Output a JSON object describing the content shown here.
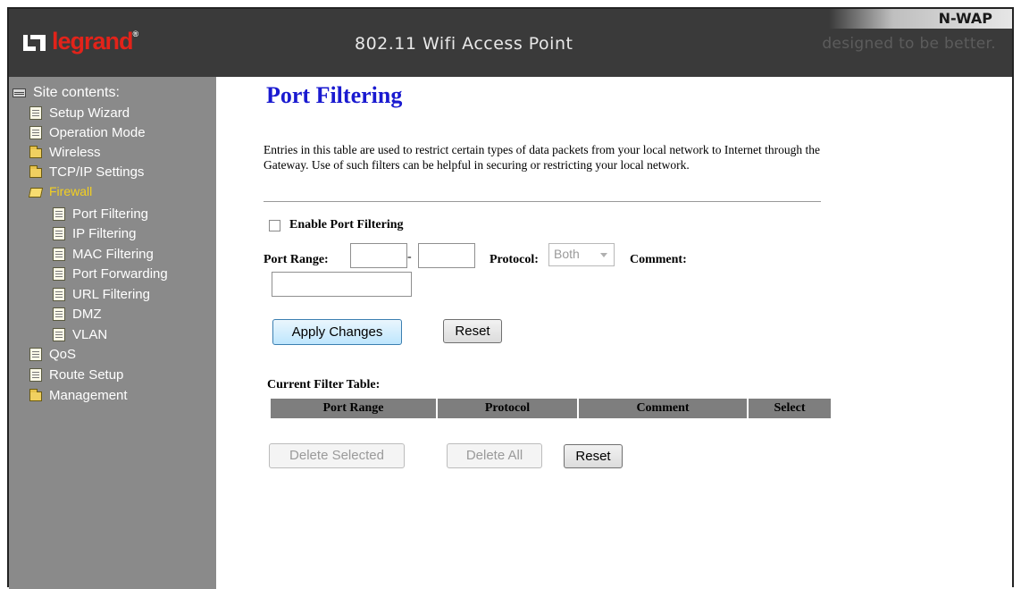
{
  "header": {
    "logo_text": "legrand",
    "title": "802.11 Wifi Access Point",
    "product": "N-WAP",
    "tagline": "designed to be better."
  },
  "sidebar": {
    "heading": "Site contents:",
    "items": [
      {
        "label": "Setup Wizard",
        "icon": "document-icon"
      },
      {
        "label": "Operation Mode",
        "icon": "document-icon"
      },
      {
        "label": "Wireless",
        "icon": "folder-icon"
      },
      {
        "label": "TCP/IP Settings",
        "icon": "folder-icon"
      },
      {
        "label": "Firewall",
        "icon": "folder-open-icon",
        "active": true
      },
      {
        "label": "Port Filtering",
        "icon": "document-icon"
      },
      {
        "label": "IP Filtering",
        "icon": "document-icon"
      },
      {
        "label": "MAC Filtering",
        "icon": "document-icon"
      },
      {
        "label": "Port Forwarding",
        "icon": "document-icon"
      },
      {
        "label": "URL Filtering",
        "icon": "document-icon"
      },
      {
        "label": "DMZ",
        "icon": "document-icon"
      },
      {
        "label": "VLAN",
        "icon": "document-icon"
      },
      {
        "label": "QoS",
        "icon": "document-icon"
      },
      {
        "label": "Route Setup",
        "icon": "document-icon"
      },
      {
        "label": "Management",
        "icon": "folder-icon"
      }
    ]
  },
  "main": {
    "title": "Port Filtering",
    "description": "Entries in this table are used to restrict certain types of data packets from your local network to Internet through the Gateway. Use of such filters can be helpful in securing or restricting your local network.",
    "enable_label": "Enable Port Filtering",
    "enable_checked": false,
    "port_range_label": "Port Range:",
    "port_from_value": "",
    "port_to_value": "",
    "dash": "-",
    "protocol_label": "Protocol:",
    "protocol_value": "Both",
    "comment_label": "Comment:",
    "comment_value": "",
    "apply_label": "Apply Changes",
    "reset_label": "Reset",
    "table_label": "Current Filter Table:",
    "table_columns": [
      "Port Range",
      "Protocol",
      "Comment",
      "Select"
    ],
    "delete_selected_label": "Delete Selected",
    "delete_all_label": "Delete All",
    "reset2_label": "Reset"
  },
  "colors": {
    "header_bg": "#3a3a3a",
    "sidebar_bg": "#8a8a8a",
    "brand_red": "#e2231a",
    "title_blue": "#1a1ad0",
    "active_nav": "#f4d020",
    "table_header_bg": "#7e7e7e"
  }
}
